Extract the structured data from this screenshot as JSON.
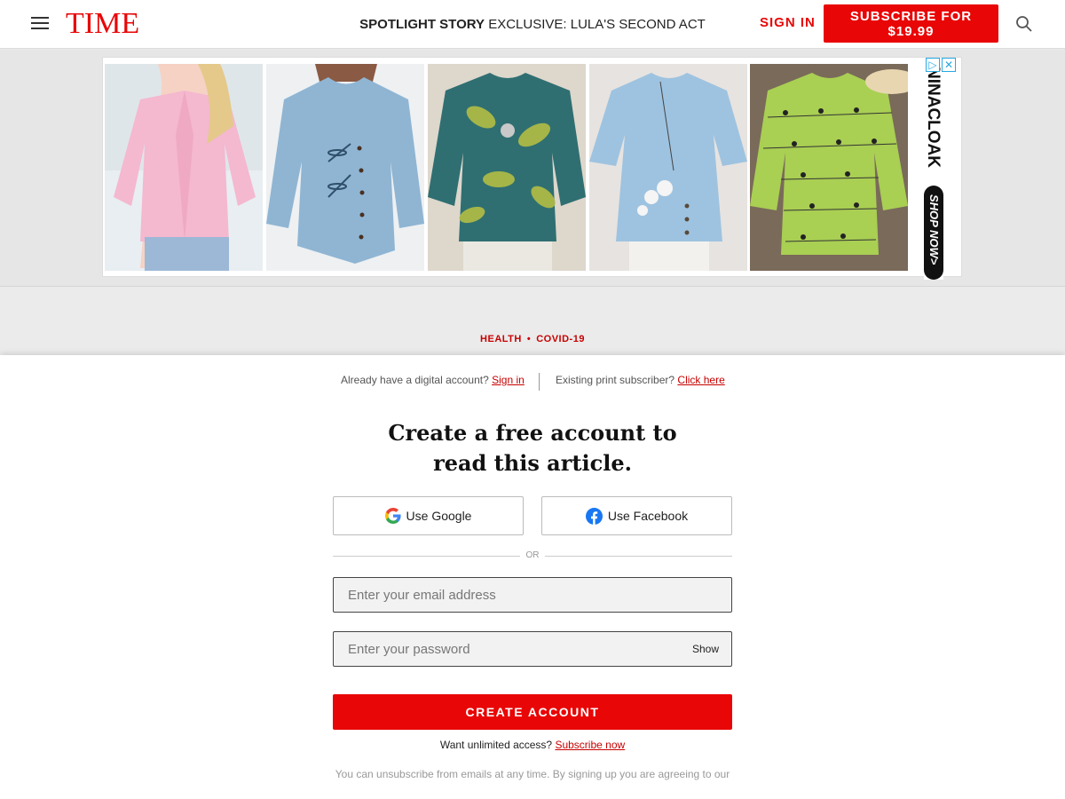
{
  "header": {
    "logo": "TIME",
    "spotlight_label": "SPOTLIGHT STORY",
    "spotlight_title": "EXCLUSIVE: LULA'S SECOND ACT",
    "sign_in": "SIGN IN",
    "subscribe": "SUBSCRIBE FOR $19.99"
  },
  "ad": {
    "brand": "NINACLOAK",
    "cta": "SHOP NOW>",
    "close": "✕",
    "adchoices": "▷",
    "products": [
      {
        "color": "#f4b8cf",
        "name": "pink-blouse"
      },
      {
        "color": "#8fb5d3",
        "name": "blue-dragonfly-tunic"
      },
      {
        "color": "#2f6f72",
        "name": "teal-floral-top"
      },
      {
        "color": "#9ec3e0",
        "name": "light-blue-flower-top"
      },
      {
        "color": "#a9cf53",
        "name": "green-cat-print-top"
      }
    ]
  },
  "article": {
    "tags": [
      "HEALTH",
      "COVID-19"
    ]
  },
  "modal": {
    "digital_prompt": "Already have a digital account?",
    "sign_in_link": "Sign in",
    "print_prompt": "Existing print subscriber?",
    "click_here": "Click here",
    "heading_line1": "Create a free account to",
    "heading_line2": "read this article.",
    "google_button": "Use Google",
    "facebook_button": "Use Facebook",
    "or": "OR",
    "email_placeholder": "Enter your email address",
    "password_placeholder": "Enter your password",
    "show": "Show",
    "create_account": "CREATE ACCOUNT",
    "unlimited_prompt": "Want unlimited access?",
    "subscribe_now": "Subscribe now",
    "fineprint": "You can unsubscribe from emails at any time. By signing up you are agreeing to our"
  }
}
